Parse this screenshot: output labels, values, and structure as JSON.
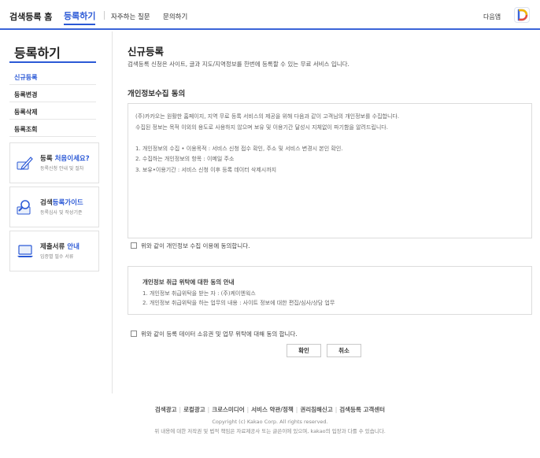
{
  "header": {
    "brand": "검색등록 홈",
    "active_tab": "등록하기",
    "links": [
      "자주하는 질문",
      "문의하기"
    ],
    "daum": "다음앱"
  },
  "sidebar": {
    "title": "등록하기",
    "items": [
      {
        "label": "신규등록",
        "active": true
      },
      {
        "label": "등록변경",
        "active": false
      },
      {
        "label": "등록삭제",
        "active": false
      },
      {
        "label": "등록조회",
        "active": false
      }
    ],
    "promos": [
      {
        "title_pre": "등록 ",
        "title_hl": "처음이세요?",
        "title_post": "",
        "sub": "등록신청 안내 및 절차",
        "icon": "pencil-icon"
      },
      {
        "title_pre": "검색",
        "title_hl": "등록가이드",
        "title_post": "",
        "sub": "등록심사 및 작성기준",
        "icon": "magnifier-icon"
      },
      {
        "title_pre": "제출서류 ",
        "title_hl": "안내",
        "title_post": "",
        "sub": "입증별 필수 서류",
        "icon": "laptop-icon"
      }
    ]
  },
  "main": {
    "title": "신규등록",
    "description": "검색등록 신청은 사이트, 글과 지도/지역정보를 한번에 등록할 수 있는 무료 서비스 입니다.",
    "section_title": "개인정보수집 동의",
    "privacy_lines": [
      "(주)카카오는 원활한 홈페이지, 지역 무료 등록 서비스의 제공을 위해 다음과 같이 고객님의 개인정보를 수집합니다.",
      "수집된 정보는 목적 이외의 용도로 사용하지 않으며 보유 및 이용기간 달성시 지체없이 파기함을 알려드립니다.",
      "",
      "1. 개인정보의 수집 • 이용목적 : 서비스 신청 접수 확인,  주소 및 서비스 변경시 본인 확인.",
      "2. 수집하는 개인정보의 항목 : 이메일 주소",
      "3. 보유•이용기간 : 서비스 신청 이후 등록 데이터 삭제시까지"
    ],
    "agree1": "위와 같이 개인정보 수집 이용에 동의합니다.",
    "entrust_title": "개인정보 취급 위탁에 대한 동의 안내",
    "entrust_lines": [
      "1. 개인정보 취급위탁을 받는 자 : (주)케이엔웍스",
      "2. 개인정보 취급위탁을 하는 업무의 내용 : 사이트 정보에 대한 편집/심사/상담 업무"
    ],
    "agree2": "위와 같이 등록 데이터 소유권 및 업무 위탁에 대해 동의 합니다.",
    "confirm_button": "확인",
    "cancel_button": "취소"
  },
  "footer": {
    "links": [
      "검색광고",
      "로컬광고",
      "크로스미디어",
      "서비스 약관/정책",
      "권리침해신고",
      "검색등록 고객센터"
    ],
    "copyright": "Copyright (c) Kakao Corp. All rights reserved.",
    "disclaimer": "위 내용에 대한 저작권 및 법적 책임은 자료제공사 또는 글쓴이에 있으며, kakao의 입장과 다를 수 있습니다."
  },
  "colors": {
    "accent": "#2b59d6",
    "border": "#dcdcdc",
    "daum_logo": [
      "#f5b800",
      "#3a64d8",
      "#e94e3c"
    ]
  }
}
